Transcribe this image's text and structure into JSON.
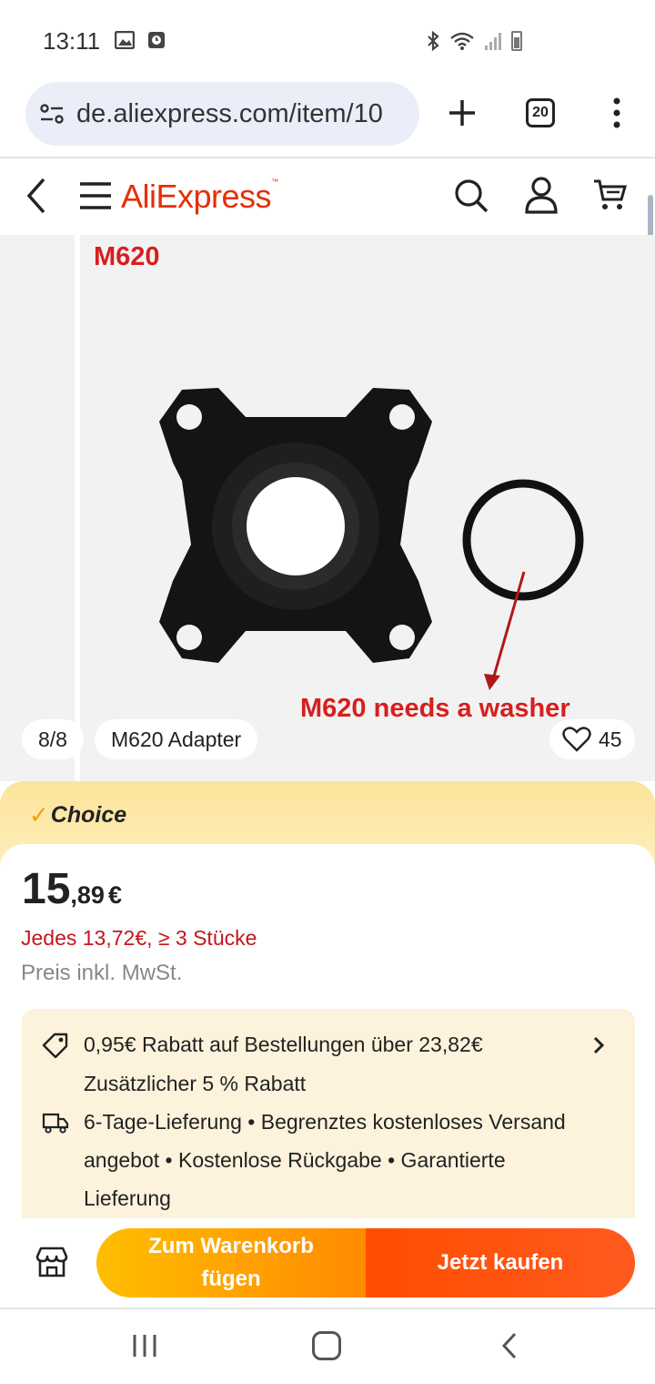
{
  "status_bar": {
    "time": "13:11"
  },
  "browser": {
    "url": "de.aliexpress.com/item/10",
    "tab_count": "20"
  },
  "header": {
    "logo": "AliExpress",
    "logo_mark": "™"
  },
  "gallery": {
    "image_label": "M620",
    "image_caption": "M620 needs a washer",
    "page_indicator": "8/8",
    "variant_title": "M620 Adapter",
    "wishlist_count": "45"
  },
  "choice": {
    "label": "Choice"
  },
  "price": {
    "integer": "15",
    "decimal": ",89",
    "currency": "€",
    "bulk_offer": "Jedes 13,72€, ≥ 3 Stücke",
    "vat_note": "Preis inkl. MwSt."
  },
  "promo": {
    "discount": "0,95€ Rabatt auf Bestellungen über 23,82€",
    "extra_discount": "Zusätzlicher 5 % Rabatt",
    "shipping_line1": "6-Tage-Lieferung • Begrenztes kostenloses Versand",
    "shipping_line2": "angebot • Kostenlose Rückgabe • Garantierte",
    "shipping_line3": "Lieferung"
  },
  "actions": {
    "add_to_cart": "Zum Warenkorb fügen",
    "buy_now": "Jetzt kaufen"
  },
  "colors": {
    "brand": "#e62e04",
    "cart_button": "#ffa500",
    "buy_button": "#ff4d00",
    "choice_band": "#fde49a"
  }
}
